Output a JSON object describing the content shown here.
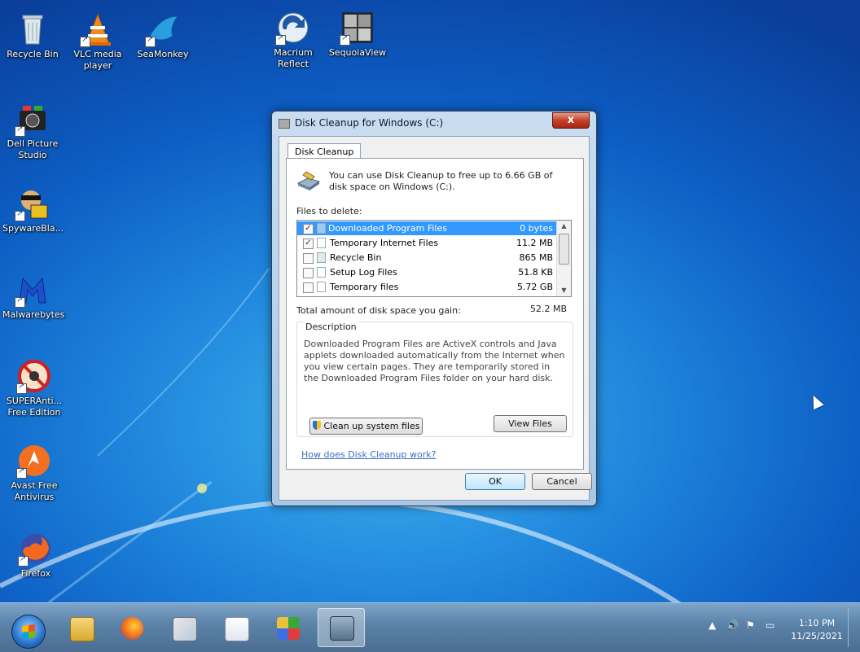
{
  "desktop": {
    "icons": [
      {
        "label": "Recycle Bin",
        "icon": "recycle-bin-icon"
      },
      {
        "label": "VLC media player",
        "icon": "vlc-icon"
      },
      {
        "label": "SeaMonkey",
        "icon": "seamonkey-icon"
      },
      {
        "label": "Macrium Reflect",
        "icon": "macrium-icon"
      },
      {
        "label": "SequoiaView",
        "icon": "sequoiaview-icon"
      },
      {
        "label": "Dell Picture Studio",
        "icon": "dell-picture-studio-icon"
      },
      {
        "label": "SpywareBla...",
        "icon": "spywareblaster-icon"
      },
      {
        "label": "Malwarebytes",
        "icon": "malwarebytes-icon"
      },
      {
        "label": "SUPERAnti... Free Edition",
        "icon": "superantispyware-icon"
      },
      {
        "label": "Avast Free Antivirus",
        "icon": "avast-icon"
      },
      {
        "label": "Firefox",
        "icon": "firefox-icon"
      }
    ]
  },
  "dialog": {
    "title": "Disk Cleanup for Windows (C:)",
    "close": "x",
    "tab": "Disk Cleanup",
    "intro": "You can use Disk Cleanup to free up to 6.66 GB of disk space on Windows (C:).",
    "files_label": "Files to delete:",
    "files": [
      {
        "name": "Downloaded Program Files",
        "size": "0 bytes",
        "checked": true,
        "selected": true
      },
      {
        "name": "Temporary Internet Files",
        "size": "11.2 MB",
        "checked": true,
        "selected": false
      },
      {
        "name": "Recycle Bin",
        "size": "865 MB",
        "checked": false,
        "selected": false
      },
      {
        "name": "Setup Log Files",
        "size": "51.8 KB",
        "checked": false,
        "selected": false
      },
      {
        "name": "Temporary files",
        "size": "5.72 GB",
        "checked": false,
        "selected": false
      }
    ],
    "total_label": "Total amount of disk space you gain:",
    "total_value": "52.2 MB",
    "description_title": "Description",
    "description": "Downloaded Program Files are ActiveX controls and Java applets downloaded automatically from the Internet when you view certain pages. They are temporarily stored in the Downloaded Program Files folder on your hard disk.",
    "clean_button": "Clean up system files",
    "view_button": "View Files",
    "help_link": "How does Disk Cleanup work?",
    "ok": "OK",
    "cancel": "Cancel"
  },
  "taskbar": {
    "apps": [
      "start-orb",
      "explorer-icon",
      "firefox-icon",
      "paint-icon",
      "photo-icon",
      "control-panel-icon",
      "disk-cleanup-icon"
    ],
    "time": "1:10 PM",
    "date": "11/25/2021"
  }
}
